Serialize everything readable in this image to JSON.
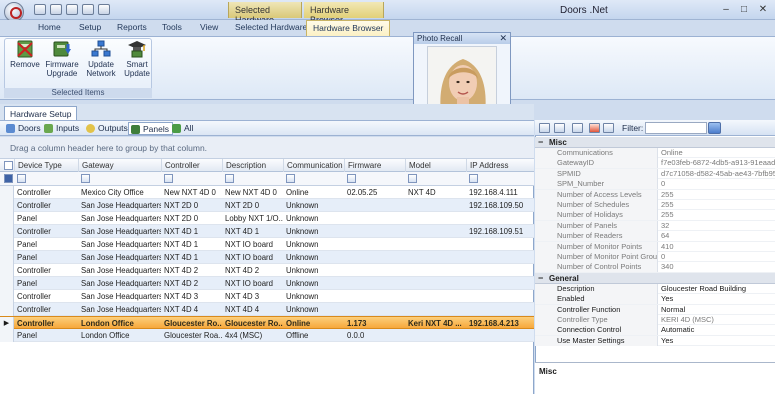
{
  "window": {
    "title": "Doors .Net",
    "context_tabs": [
      "Selected Hardware",
      "Hardware Browser"
    ],
    "controls": [
      "–",
      "□",
      "✕"
    ]
  },
  "ribbon": {
    "tabs": [
      "Home",
      "Setup",
      "Reports",
      "Tools",
      "View",
      "Selected Hardware",
      "Hardware Browser"
    ],
    "active_tab": "Hardware Browser",
    "group": {
      "label": "Selected Items",
      "buttons": [
        {
          "label": "Remove",
          "icon": "remove-icon"
        },
        {
          "label": "Firmware Upgrade",
          "icon": "firmware-upgrade-icon"
        },
        {
          "label": "Update Network",
          "icon": "update-network-icon"
        },
        {
          "label": "Smart Update",
          "icon": "smart-update-icon"
        }
      ]
    }
  },
  "photo_recall": {
    "title": "Photo Recall",
    "close": "✕"
  },
  "hardware_setup": {
    "tab": "Hardware Setup",
    "subtabs": [
      "Doors",
      "Inputs",
      "Outputs",
      "Panels",
      "All"
    ],
    "active_subtab": "Panels",
    "group_hint": "Drag a column header here to group by that column.",
    "columns": [
      "Device Type",
      "Gateway",
      "Controller",
      "Description",
      "Communication",
      "Firmware",
      "Model",
      "IP Address"
    ],
    "rows": [
      [
        "Controller",
        "Mexico City Office",
        "New NXT 4D 0",
        "New NXT 4D 0",
        "Online",
        "02.05.25",
        "NXT 4D",
        "192.168.4.111"
      ],
      [
        "Controller",
        "San Jose Headquarters",
        "NXT 2D 0",
        "NXT 2D 0",
        "Unknown",
        "",
        "",
        "192.168.109.50"
      ],
      [
        "Panel",
        "San Jose Headquarters",
        "NXT 2D 0",
        "Lobby NXT 1/O...",
        "Unknown",
        "",
        "",
        ""
      ],
      [
        "Controller",
        "San Jose Headquarters",
        "NXT 4D 1",
        "NXT 4D 1",
        "Unknown",
        "",
        "",
        "192.168.109.51"
      ],
      [
        "Panel",
        "San Jose Headquarters",
        "NXT 4D 1",
        "NXT IO board",
        "Unknown",
        "",
        "",
        ""
      ],
      [
        "Panel",
        "San Jose Headquarters",
        "NXT 4D 1",
        "NXT IO board",
        "Unknown",
        "",
        "",
        ""
      ],
      [
        "Controller",
        "San Jose Headquarters",
        "NXT 4D 2",
        "NXT 4D 2",
        "Unknown",
        "",
        "",
        ""
      ],
      [
        "Panel",
        "San Jose Headquarters",
        "NXT 4D 2",
        "NXT IO board",
        "Unknown",
        "",
        "",
        ""
      ],
      [
        "Controller",
        "San Jose Headquarters",
        "NXT 4D 3",
        "NXT 4D 3",
        "Unknown",
        "",
        "",
        ""
      ],
      [
        "Controller",
        "San Jose Headquarters",
        "NXT 4D 4",
        "NXT 4D 4",
        "Unknown",
        "",
        "",
        ""
      ],
      [
        "Controller",
        "London Office",
        "Gloucester Ro...",
        "Gloucester Ro...",
        "Online",
        "1.173",
        "Keri NXT 4D ...",
        "192.168.4.213"
      ],
      [
        "Panel",
        "London Office",
        "Gloucester Roa...",
        "4x4 (MSC)",
        "Offline",
        "0.0.0",
        "",
        ""
      ]
    ],
    "selected_row": 10
  },
  "properties": {
    "filter_label": "Filter:",
    "categories": [
      {
        "name": "Misc",
        "items": [
          [
            "Communications",
            "Online"
          ],
          [
            "GatewayID",
            "f7e03feb-6872-4db5-a913-91eaadf81e..."
          ],
          [
            "SPMID",
            "d7c71058-d582-45ab-ae43-7bfb95f70a..."
          ],
          [
            "SPM_Number",
            "0"
          ],
          [
            "Number of Access Levels",
            "255"
          ],
          [
            "Number of Schedules",
            "255"
          ],
          [
            "Number of Holidays",
            "255"
          ],
          [
            "Number of Panels",
            "32"
          ],
          [
            "Number of Readers",
            "64"
          ],
          [
            "Number of Monitor Points",
            "410"
          ],
          [
            "Number of Monitor Point Groups",
            "0"
          ],
          [
            "Number of Control Points",
            "340"
          ]
        ]
      },
      {
        "name": "General",
        "items": [
          [
            "Description",
            "Gloucester Road Building"
          ],
          [
            "Enabled",
            "Yes"
          ],
          [
            "Controller Function",
            "Normal"
          ],
          [
            "Controller Type",
            "KERI 4D (MSC)"
          ],
          [
            "Connection Control",
            "Automatic"
          ],
          [
            "Use Master Settings",
            "Yes"
          ]
        ]
      }
    ],
    "description_title": "Misc"
  }
}
